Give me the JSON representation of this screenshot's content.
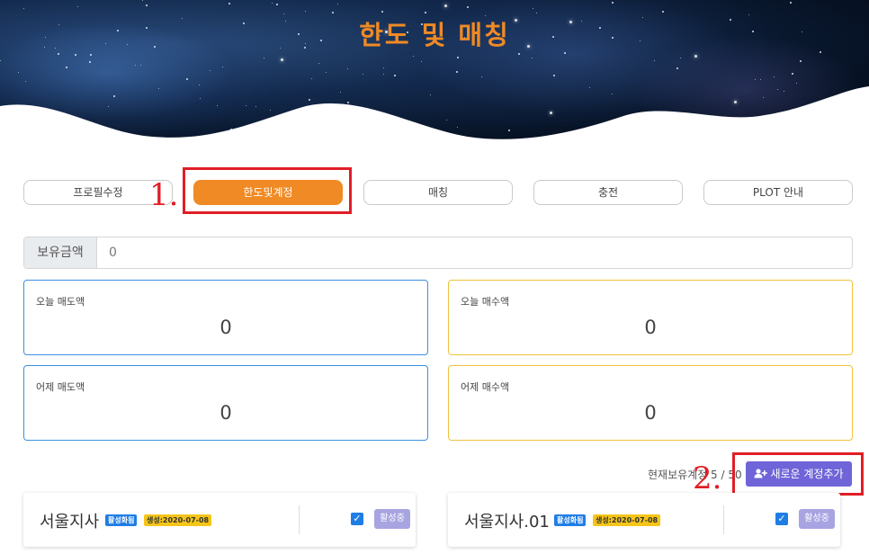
{
  "header": {
    "title": "한도 및 매칭"
  },
  "tabs": [
    {
      "label": "프로필수정",
      "active": false
    },
    {
      "label": "한도및계정",
      "active": true
    },
    {
      "label": "매칭",
      "active": false
    },
    {
      "label": "충전",
      "active": false
    },
    {
      "label": "PLOT 안내",
      "active": false
    }
  ],
  "annotations": {
    "one": "1.",
    "two": "2."
  },
  "balance": {
    "label": "보유금액",
    "value": "0"
  },
  "stats": {
    "today_sell": {
      "label": "오늘 매도액",
      "value": "0"
    },
    "today_buy": {
      "label": "오늘 매수액",
      "value": "0"
    },
    "yesterday_sell": {
      "label": "어제 매도액",
      "value": "0"
    },
    "yesterday_buy": {
      "label": "어제 매수액",
      "value": "0"
    }
  },
  "accounts_summary": {
    "count_text": "현재보유계정 5 / 50",
    "add_button": "새로운 계정추가"
  },
  "accounts": [
    {
      "name": "서울지사",
      "status_badge": "활성화됨",
      "created_badge": "생성:2020-07-08",
      "checked": true,
      "status_button": "활성중"
    },
    {
      "name": "서울지사.01",
      "status_badge": "활성화됨",
      "created_badge": "생성:2020-07-08",
      "checked": true,
      "status_button": "활성중"
    }
  ],
  "colors": {
    "accent": "#f08a24",
    "primary": "#6f64d8",
    "blue": "#3d8fe0",
    "yellow": "#f0c23c",
    "annotation": "#e01e26"
  },
  "icons": {
    "add_user": "add-user-icon",
    "check": "check-icon"
  }
}
